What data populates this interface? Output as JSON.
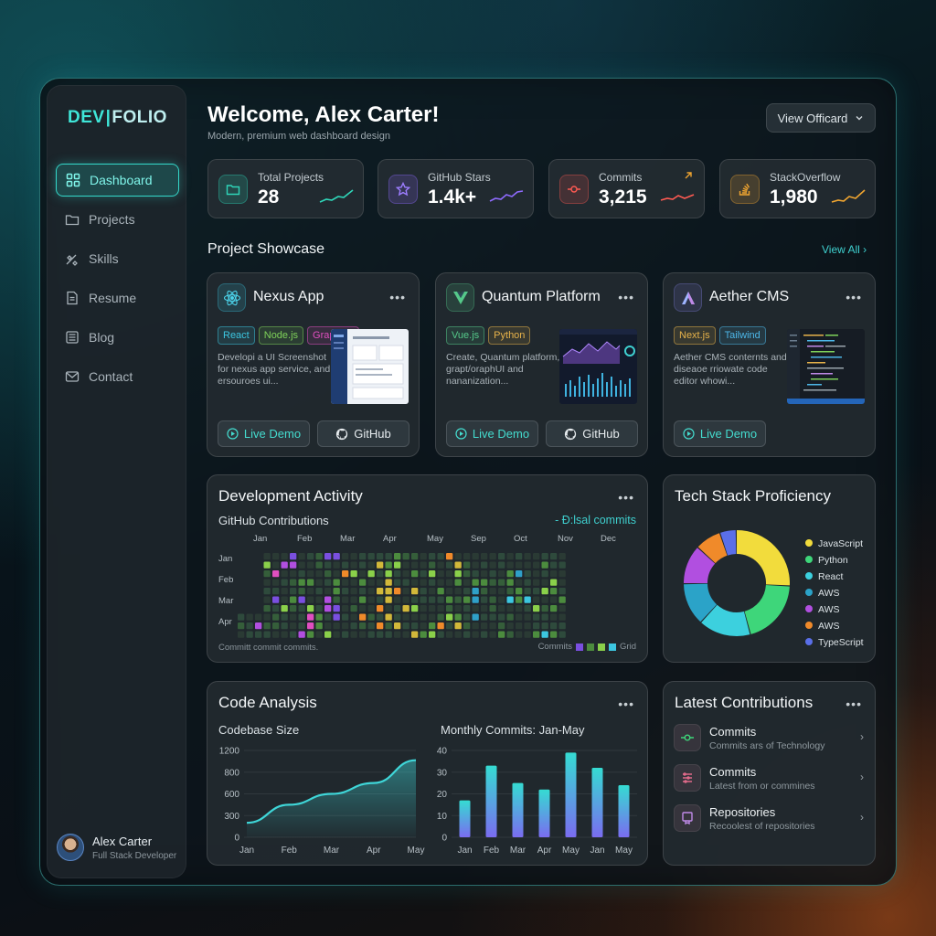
{
  "brand": {
    "part1": "DEV",
    "part2": "FOLIO"
  },
  "nav": [
    {
      "label": "Dashboard",
      "icon": "grid-icon",
      "active": true
    },
    {
      "label": "Projects",
      "icon": "folder-icon"
    },
    {
      "label": "Skills",
      "icon": "satellite-icon"
    },
    {
      "label": "Resume",
      "icon": "document-icon"
    },
    {
      "label": "Blog",
      "icon": "newspaper-icon"
    },
    {
      "label": "Contact",
      "icon": "mail-icon"
    }
  ],
  "profile": {
    "name": "Alex Carter",
    "role": "Full Stack Developer"
  },
  "header": {
    "title": "Welcome, Alex Carter!",
    "subtitle": "Modern, premium web dashboard design",
    "view_button": "View Officard"
  },
  "stats": [
    {
      "label": "Total Projects",
      "value": "28",
      "icon": "folder-icon",
      "color": "#2fd6b9"
    },
    {
      "label": "GitHub Stars",
      "value": "1.4k+",
      "icon": "star-icon",
      "color": "#8f6bff"
    },
    {
      "label": "Commits",
      "value": "3,215",
      "icon": "commit-icon",
      "color": "#ff5a52"
    },
    {
      "label": "StackOverflow",
      "value": "1,980",
      "icon": "stackoverflow-icon",
      "color": "#f0a530"
    }
  ],
  "showcase": {
    "title": "Project Showcase",
    "view_all": "View All"
  },
  "projects": [
    {
      "title": "Nexus App",
      "icon": "react-icon",
      "tags": [
        {
          "label": "React",
          "color": "#3cc6e0"
        },
        {
          "label": "Node.js",
          "color": "#7fd25a"
        },
        {
          "label": "GraphQL",
          "color": "#e04fc0"
        }
      ],
      "desc": "Developi a UI Screenshot for nexus app service, and ersouroes ui...",
      "demo": "Live Demo",
      "github": "GitHub"
    },
    {
      "title": "Quantum Platform",
      "icon": "vue-icon",
      "tags": [
        {
          "label": "Vue.js",
          "color": "#55c98a"
        },
        {
          "label": "Python",
          "color": "#e6b24a"
        }
      ],
      "desc": "Create, Quantum platform, grapt/oraphUI and nananization...",
      "demo": "Live Demo",
      "github": "GitHub"
    },
    {
      "title": "Aether CMS",
      "icon": "aether-icon",
      "tags": [
        {
          "label": "Next.js",
          "color": "#e6b24a"
        },
        {
          "label": "Tailwind",
          "color": "#4db7e8"
        }
      ],
      "desc": "Aether CMS conternts and diseaoe rriowate code editor whowi...",
      "demo": "Live Demo"
    }
  ],
  "activity": {
    "title": "Development Activity",
    "subtitle": "GitHub Contributions",
    "link": "- Đ:lsal commits",
    "months": [
      "Jan",
      "Feb",
      "Mar",
      "Apr",
      "May",
      "Sep",
      "Oct",
      "Nov",
      "Dec"
    ],
    "rows": [
      "Jan",
      "Feb",
      "Mar",
      "Apr"
    ],
    "footer_left": "Committ commit commits.",
    "legend_left": "Commits",
    "legend_right": "Grid"
  },
  "tech": {
    "title": "Tech Stack Proficiency",
    "items": [
      {
        "label": "JavaScript",
        "color": "#f2dc3c",
        "value": 26
      },
      {
        "label": "Python",
        "color": "#3ed67a",
        "value": 20
      },
      {
        "label": "React",
        "color": "#3cd0de",
        "value": 16
      },
      {
        "label": "AWS",
        "color": "#2ba3c8",
        "value": 13
      },
      {
        "label": "AWS",
        "color": "#b14fe0",
        "value": 12
      },
      {
        "label": "AWS",
        "color": "#f08a2a",
        "value": 8
      },
      {
        "label": "TypeScript",
        "color": "#5a6fe8",
        "value": 5
      }
    ]
  },
  "code": {
    "title": "Code Analysis",
    "left_title": "Codebase Size",
    "right_title": "Monthly Commits: Jan-May"
  },
  "chart_data": [
    {
      "type": "area",
      "title": "Codebase Size",
      "x": [
        "Jan",
        "Feb",
        "Mar",
        "Apr",
        "May"
      ],
      "y_ticks": [
        0,
        300,
        600,
        800,
        1200
      ],
      "values": [
        200,
        450,
        600,
        700,
        1020
      ],
      "color": "#3fd6d8"
    },
    {
      "type": "bar",
      "title": "Monthly Commits: Jan-May",
      "categories": [
        "Jan",
        "Feb",
        "Mar",
        "Apr",
        "May",
        "Jan",
        "May"
      ],
      "values": [
        17,
        33,
        25,
        22,
        39,
        32,
        24
      ],
      "y_ticks": [
        0,
        10,
        20,
        30,
        40
      ],
      "ylim": [
        0,
        40
      ]
    }
  ],
  "latest": {
    "title": "Latest Contributions",
    "items": [
      {
        "title": "Commits",
        "sub": "Commits ars of Technology",
        "icon": "commit-icon",
        "color": "#3ed67a"
      },
      {
        "title": "Commits",
        "sub": "Latest from or commines",
        "icon": "list-icon",
        "color": "#e06a8a"
      },
      {
        "title": "Repositories",
        "sub": "Recoolest of repositories",
        "icon": "repo-icon",
        "color": "#c08ae8"
      }
    ]
  }
}
